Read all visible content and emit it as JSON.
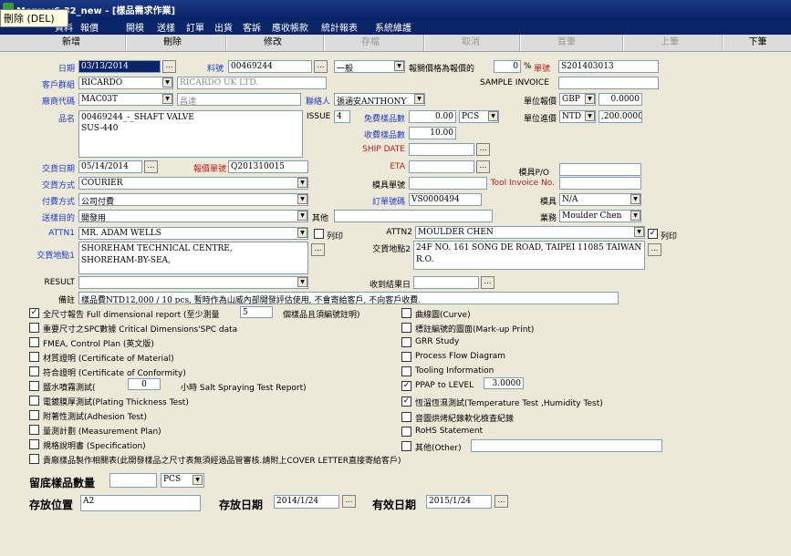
{
  "window": {
    "title": "Menu v6.32_new - [樣品需求作業]"
  },
  "tooltip": "刪除 (DEL)",
  "menu": [
    "資料",
    "報價",
    "開模",
    "送樣",
    "訂單",
    "出貨",
    "客訴",
    "應收帳款",
    "統計報表",
    "系統維護"
  ],
  "toolbar": [
    "新增",
    "刪除",
    "修改",
    "存檔",
    "取消",
    "首筆",
    "上筆",
    "下筆"
  ],
  "form": {
    "date_label": "日期",
    "date": "03/13/2014",
    "part_label": "料號",
    "part": "00469244",
    "type": "一般",
    "quote_label": "報關價格為報價的",
    "quote_pct": "0",
    "pct_sign": "%",
    "sheet_label": "單號",
    "sheet": "S201403013",
    "group_label": "客戶群組",
    "group": "RICARDO",
    "group_name": "RICARDO UK LTD.",
    "sample_invoice_label": "SAMPLE INVOICE",
    "vendor_label": "廠商代碼",
    "vendor": "MAC03T",
    "vendor_name": "昌達",
    "contact_label": "聯絡人",
    "contact": "張涵安ANTHONY",
    "unit_quote_label": "單位報價",
    "unit_quote_cur": "GBP",
    "unit_quote": "0.0000",
    "product_label": "品名",
    "product_line1": "00469244_-_SHAFT VALVE",
    "product_line2": "SUS-440",
    "issue_label": "ISSUE",
    "issue": "4",
    "free_qty_label": "免費樣品數",
    "free_qty": "0.00",
    "free_unit": "PCS",
    "unit_in_label": "單位進價",
    "unit_in_cur": "NTD",
    "unit_in": ",200.0000",
    "charge_qty_label": "收費樣品數",
    "charge_qty": "10.00",
    "ship_date_label": "SHIP DATE",
    "delivery_label": "交貨日期",
    "delivery": "05/14/2014",
    "quote_no_label": "報價單號",
    "quote_no": "Q201310015",
    "eta_label": "ETA",
    "mold_po_label": "模具P/O",
    "ship_method_label": "交貨方式",
    "ship_method": "COURIER",
    "mold_sheet_label": "模具單號",
    "tooling_inv_label": "Tool Invoice No.",
    "pay_label": "付費方式",
    "pay": "公司付費",
    "order_label": "訂單號碼",
    "order": "VS0000494",
    "mold_label": "模具",
    "mold": "N/A",
    "purpose_label": "送樣目的",
    "purpose": "開發用",
    "other_label": "其他",
    "biz_label": "業務",
    "biz": "Moulder Chen",
    "attn1_label": "ATTN1",
    "attn1": "MR. ADAM WELLS",
    "print1_label": "列印",
    "attn2_label": "ATTN2",
    "attn2": "MOULDER CHEN",
    "print2_label": "列印",
    "addr1_label": "交貨地點1",
    "addr1_line1": "SHOREHAM TECHNICAL CENTRE,",
    "addr1_line2": "SHOREHAM-BY-SEA,",
    "addr2_label": "交貨地點2",
    "addr2_line1": "24F NO. 161 SONG DE ROAD, TAIPEI 11085 TAIWAN",
    "addr2_line2": "R.O.",
    "result_label": "RESULT",
    "received_label": "收到結果日",
    "note_label": "備註",
    "note": "樣品費NTD12,000 / 10 pcs, 暫時作為山威內部開發評估使用, 不會寄給客戶, 不向客戶收費."
  },
  "checks_left": [
    {
      "label": "全尺寸報告 Full dimensional report (至少測量",
      "checked": true,
      "value": "5",
      "suffix": "個樣品且須編號註明)"
    },
    {
      "label": "重要尺寸之SPC數據 Critical Dimensions'SPC data",
      "checked": false
    },
    {
      "label": "FMEA, Control Plan (英文版)",
      "checked": false
    },
    {
      "label": "材質證明 (Certificate of Material)",
      "checked": false
    },
    {
      "label": "符合證明 (Certificate of Conformity)",
      "checked": false
    },
    {
      "label": "鹽水噴霧測試(",
      "checked": false,
      "value": "0",
      "suffix": "小時 Salt Spraying Test Report)"
    },
    {
      "label": "電鍍膜厚測試(Plating Thickness Test)",
      "checked": false
    },
    {
      "label": "附著性測試(Adhesion Test)",
      "checked": false
    },
    {
      "label": "量測計劃 (Measurement Plan)",
      "checked": false
    },
    {
      "label": "規格說明書 (Specification)",
      "checked": false
    },
    {
      "label": "貴廠樣品製作相關表(此開發樣品之尺寸表無須經過品管審核.請附上COVER LETTER直接寄給客戶)",
      "checked": false
    }
  ],
  "checks_right": [
    {
      "label": "曲線圖(Curve)",
      "checked": false
    },
    {
      "label": "標註編號的圖面(Mark-up Print)",
      "checked": false
    },
    {
      "label": "GRR Study",
      "checked": false
    },
    {
      "label": "Process Flow Diagram",
      "checked": false
    },
    {
      "label": "Tooling Information",
      "checked": false
    },
    {
      "label": "PPAP  to LEVEL",
      "checked": true,
      "value": "3.0000"
    },
    {
      "label": "恆溫恆濕測試(Temperature Test ,Humidity Test)",
      "checked": true
    },
    {
      "label": "音圖烘烤紀錄軟化檢查紀錄",
      "checked": false
    },
    {
      "label": "RoHS Statement",
      "checked": false
    },
    {
      "label": "其他(Other)",
      "checked": false
    }
  ],
  "bottom": {
    "retain_label": "留底樣品數量",
    "retain_unit": "PCS",
    "loc_label": "存放位置",
    "loc": "A2",
    "store_label": "存放日期",
    "store": "2014/1/24",
    "valid_label": "有效日期",
    "valid": "2015/1/24"
  },
  "colors": {
    "title_bg": "#0a246a",
    "label_blue": "#1a3bd6",
    "label_red": "#c01818",
    "panel": "#ece9d8"
  }
}
